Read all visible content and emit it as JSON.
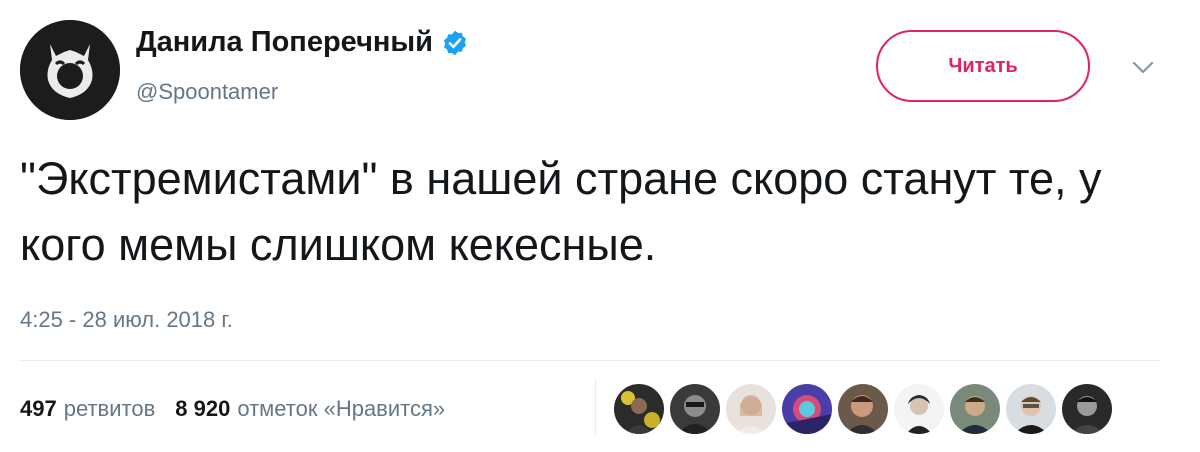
{
  "author": {
    "name": "Данила Поперечный",
    "handle": "@Spoontamer",
    "verified": true
  },
  "follow_button": {
    "label": "Читать"
  },
  "tweet": {
    "text": "\"Экстремистами\" в нашей стране скоро станут те, у кого мемы слишком кекесные.",
    "timestamp": "4:25 - 28 июл. 2018 г."
  },
  "stats": {
    "retweets_count": "497",
    "retweets_label": "ретвитов",
    "likes_count": "8 920",
    "likes_label": "отметок «Нравится»"
  },
  "colors": {
    "accent": "#e0245e",
    "verified": "#1da1f2",
    "secondary_text": "#657786"
  },
  "liker_avatars": [
    "avatar-1",
    "avatar-2",
    "avatar-3",
    "avatar-4",
    "avatar-5",
    "avatar-6",
    "avatar-7",
    "avatar-8",
    "avatar-9"
  ]
}
